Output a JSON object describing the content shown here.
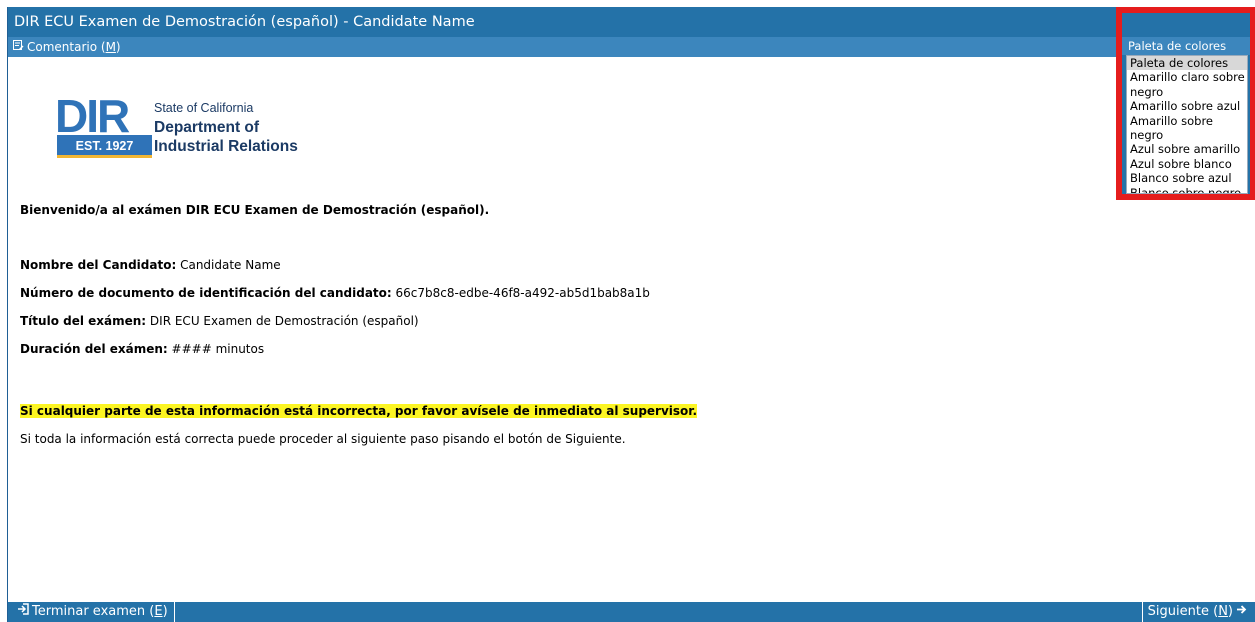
{
  "window": {
    "title": "DIR ECU Examen de Demostración (español) - Candidate Name"
  },
  "toolbar": {
    "comment_label_prefix": "Comentario (",
    "comment_label_key": "M",
    "comment_label_suffix": ")"
  },
  "logo": {
    "letters": "DIR",
    "est": "EST. 1927",
    "line1": "State of California",
    "line2": "Department of",
    "line3": "Industrial Relations"
  },
  "welcome": "Bienvenido/a al exámen DIR ECU Examen de Demostración (español).",
  "details": [
    {
      "label": "Nombre del Candidato:",
      "value": "Candidate Name"
    },
    {
      "label": "Número de documento de identificación del candidato:",
      "value": "66c7b8c8-edbe-46f8-a492-ab5d1bab8a1b"
    },
    {
      "label": "Título del exámen:",
      "value": "DIR ECU Examen de Demostración (español)"
    },
    {
      "label": "Duración del exámen:",
      "value": "#### minutos"
    }
  ],
  "warning": "Si cualquier parte de esta información está incorrecta, por favor avísele de inmediato al supervisor.",
  "instruction": "Si toda la información está correcta puede proceder al siguiente paso pisando el botón de Siguiente.",
  "palette": {
    "header": "Paleta de colores",
    "options": [
      "Paleta de colores",
      "Amarillo claro sobre negro",
      "Amarillo sobre azul",
      "Amarillo sobre negro",
      "Azul sobre amarillo",
      "Azul sobre blanco",
      "Blanco sobre azul",
      "Blanco sobre negro"
    ],
    "selected_index": 0
  },
  "footer": {
    "end_label_prefix": "Terminar examen (",
    "end_label_key": "E",
    "end_label_suffix": ")",
    "next_label_prefix": "Siguiente (",
    "next_label_key": "N",
    "next_label_suffix": ")"
  },
  "colors": {
    "titlebar": "#2472a8",
    "toolbar": "#3c86bd",
    "highlight": "#fcf523",
    "logo_blue": "#2f73b8",
    "logo_navy": "#1b3a64",
    "callout_red": "#e51d1d"
  }
}
